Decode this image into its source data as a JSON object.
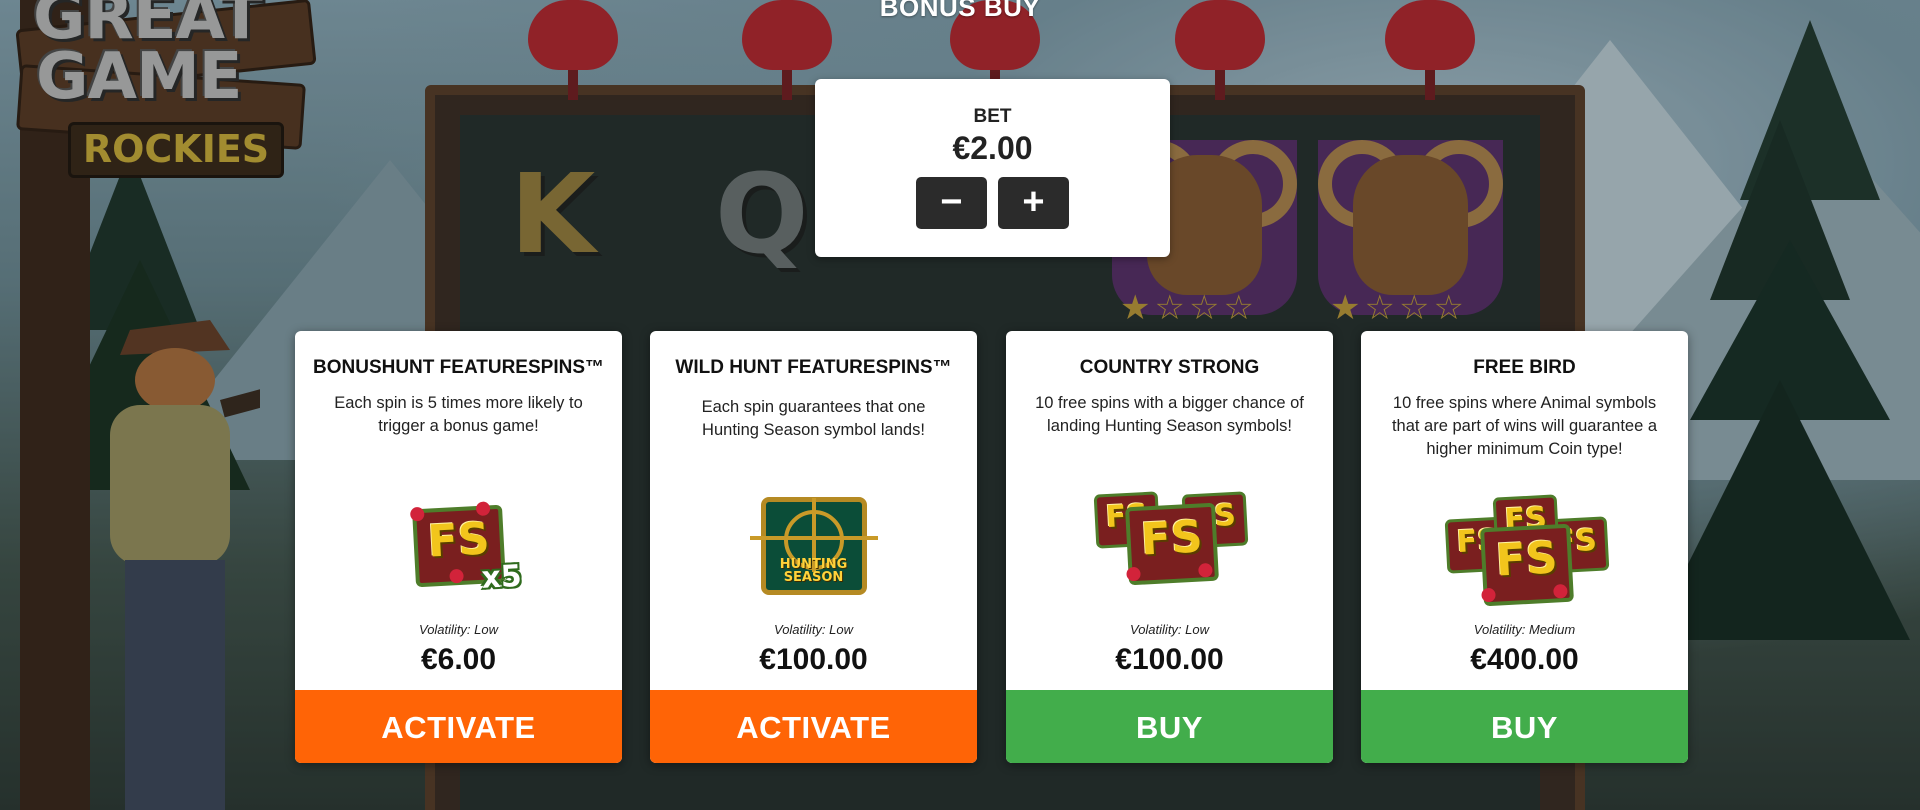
{
  "logo": {
    "line1": "GREAT",
    "line2": "GAME",
    "line3": "ROCKIES"
  },
  "background_symbols": [
    "K",
    "Q"
  ],
  "header": {
    "title": "BONUS BUY"
  },
  "bet": {
    "label": "BET",
    "value": "€2.00",
    "decrease": "−",
    "increase": "+"
  },
  "cards": [
    {
      "title": "BONUSHUNT FEATURESPINS™",
      "description": "Each spin is 5 times more likely to trigger a bonus game!",
      "icon": "fs-x5-icon",
      "icon_text": "FS",
      "icon_badge": "x5",
      "volatility": "Volatility: Low",
      "price": "€6.00",
      "action": "ACTIVATE",
      "action_color": "#ff6406"
    },
    {
      "title": "WILD HUNT FEATURESPINS™",
      "description": "Each spin guarantees that one Hunting Season symbol lands!",
      "icon": "hunting-season-icon",
      "icon_text": "HUNTING SEASON",
      "volatility": "Volatility: Low",
      "price": "€100.00",
      "action": "ACTIVATE",
      "action_color": "#ff6406"
    },
    {
      "title": "COUNTRY STRONG",
      "description": "10 free spins with a bigger chance of landing Hunting Season symbols!",
      "icon": "fs-triple-icon",
      "icon_text": "FS",
      "volatility": "Volatility: Low",
      "price": "€100.00",
      "action": "BUY",
      "action_color": "#42ad4b"
    },
    {
      "title": "FREE BIRD",
      "description": "10 free spins where Animal symbols that are part of wins will guarantee a higher minimum Coin type!",
      "icon": "fs-quad-icon",
      "icon_text": "FS",
      "volatility": "Volatility: Medium",
      "price": "€400.00",
      "action": "BUY",
      "action_color": "#42ad4b"
    }
  ]
}
